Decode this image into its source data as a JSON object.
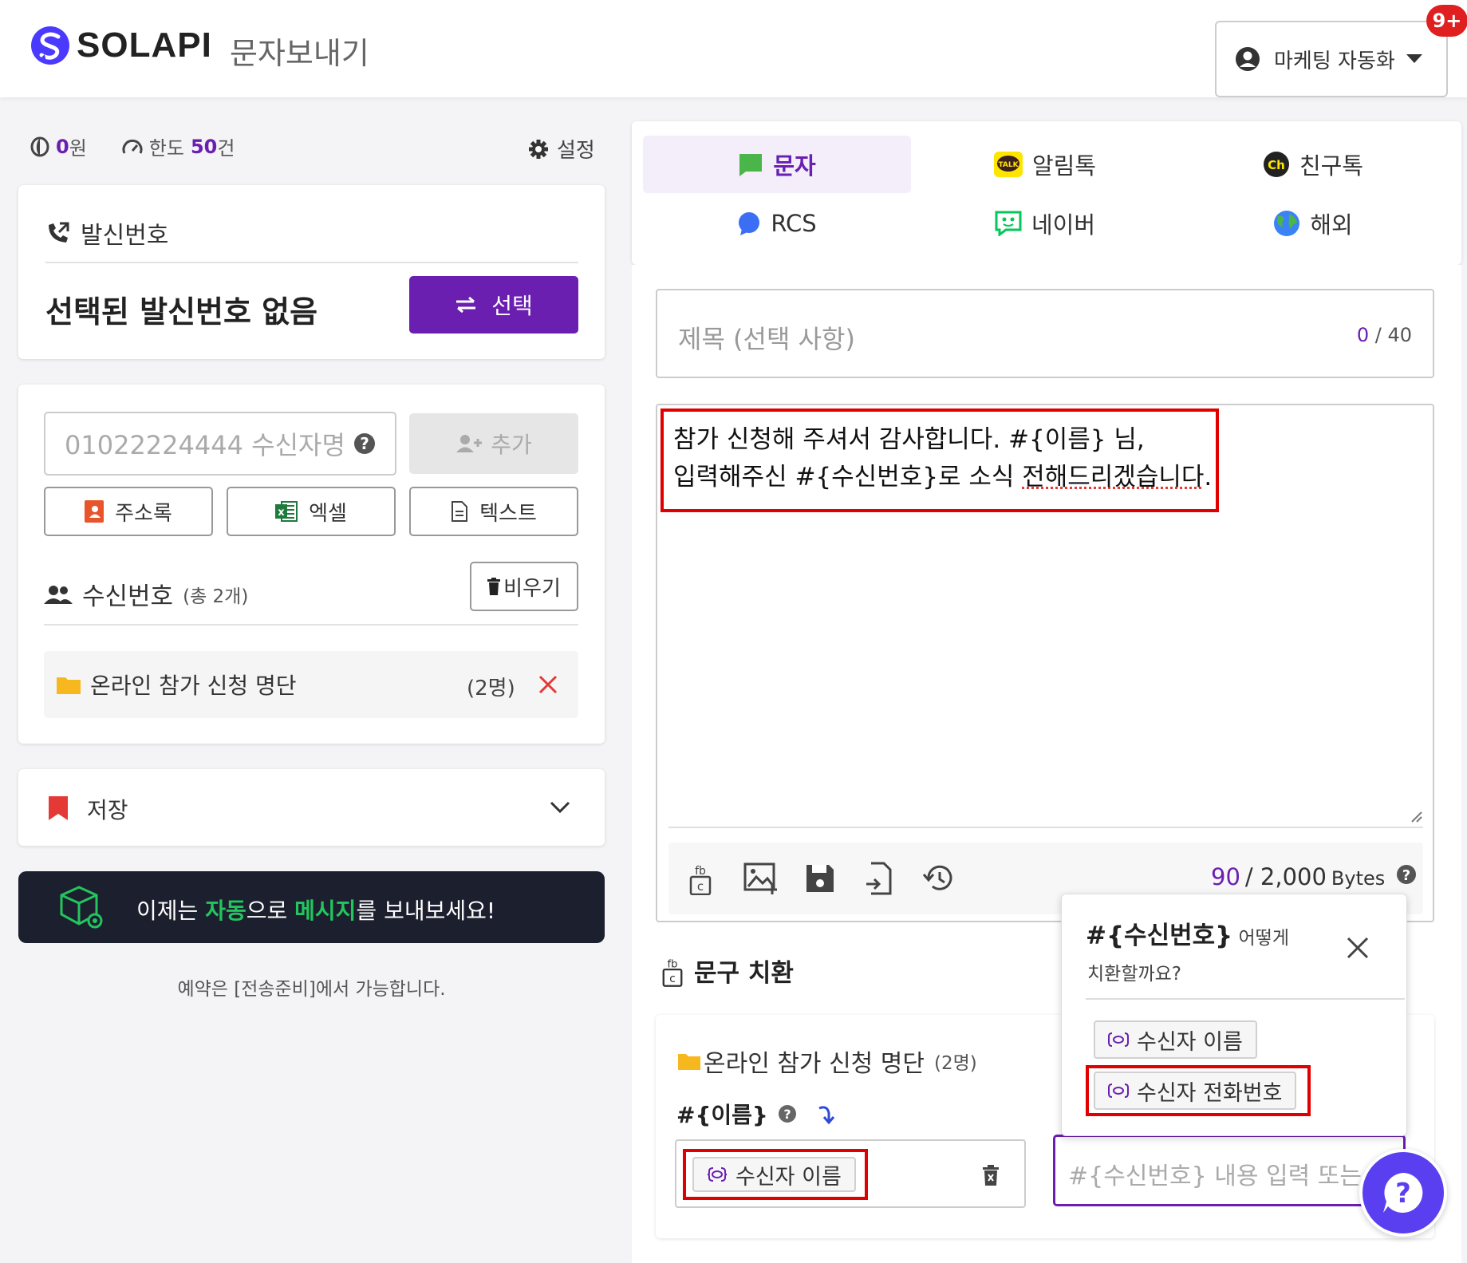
{
  "header": {
    "brand": "SOLAPI",
    "subtitle": "문자보내기",
    "account_label": "마케팅 자동화",
    "notification_badge": "9+"
  },
  "balance": {
    "amount": "0",
    "unit": "원",
    "limit_label": "한도",
    "limit_value": "50",
    "limit_unit": "건",
    "settings_label": "설정"
  },
  "sender": {
    "title": "발신번호",
    "selected_text": "선택된 발신번호 없음",
    "select_button": "선택"
  },
  "recipients": {
    "input_placeholder": "01022224444 수신자명",
    "add_button": "추가",
    "sources": [
      "주소록",
      "엑셀",
      "텍스트"
    ],
    "list_title": "수신번호",
    "list_total": "(총 2개)",
    "clear_button": "비우기",
    "groups": [
      {
        "name": "온라인 참가 신청 명단",
        "count": "(2명)"
      }
    ]
  },
  "save": {
    "label": "저장"
  },
  "promo": {
    "part1": "이제는 ",
    "highlight1": "자동",
    "part2": "으로 ",
    "highlight2": "메시지",
    "part3": "를 보내보세요!"
  },
  "reservation_note": "예약은 [전송준비]에서 가능합니다.",
  "tabs": [
    {
      "label": "문자",
      "active": true
    },
    {
      "label": "알림톡"
    },
    {
      "label": "친구톡"
    },
    {
      "label": "RCS"
    },
    {
      "label": "네이버"
    },
    {
      "label": "해외"
    }
  ],
  "message": {
    "subject_placeholder": "제목 (선택 사항)",
    "subject_count": "0",
    "subject_max": "/ 40",
    "body_line1": "참가 신청해 주셔서 감사합니다. #{이름} 님,",
    "body_line2_a": "입력해주신 #{수신번호}로 소식 ",
    "body_line2_b": "전해드리겠습니다",
    "body_line2_c": ".",
    "bytes_count": "90",
    "bytes_max": "/ 2,000",
    "bytes_unit": "Bytes"
  },
  "replace": {
    "title": "문구 치환",
    "group_name": "온라인 참가 신청 명단",
    "group_count": "(2명)",
    "var1": "#{이름}",
    "var1_value": "수신자 이름",
    "var2_placeholder": "#{수신번호} 내용 입력 또는"
  },
  "popover": {
    "var": "#{수신번호}",
    "text1": " 어떻게",
    "text2": "치환할까요?",
    "options": [
      "수신자 이름",
      "수신자 전화번호"
    ]
  },
  "colors": {
    "accent": "#6a1fb0",
    "highlight": "#e00000",
    "promo_bg": "#1c1f2e",
    "promo_green": "#22c55e"
  }
}
